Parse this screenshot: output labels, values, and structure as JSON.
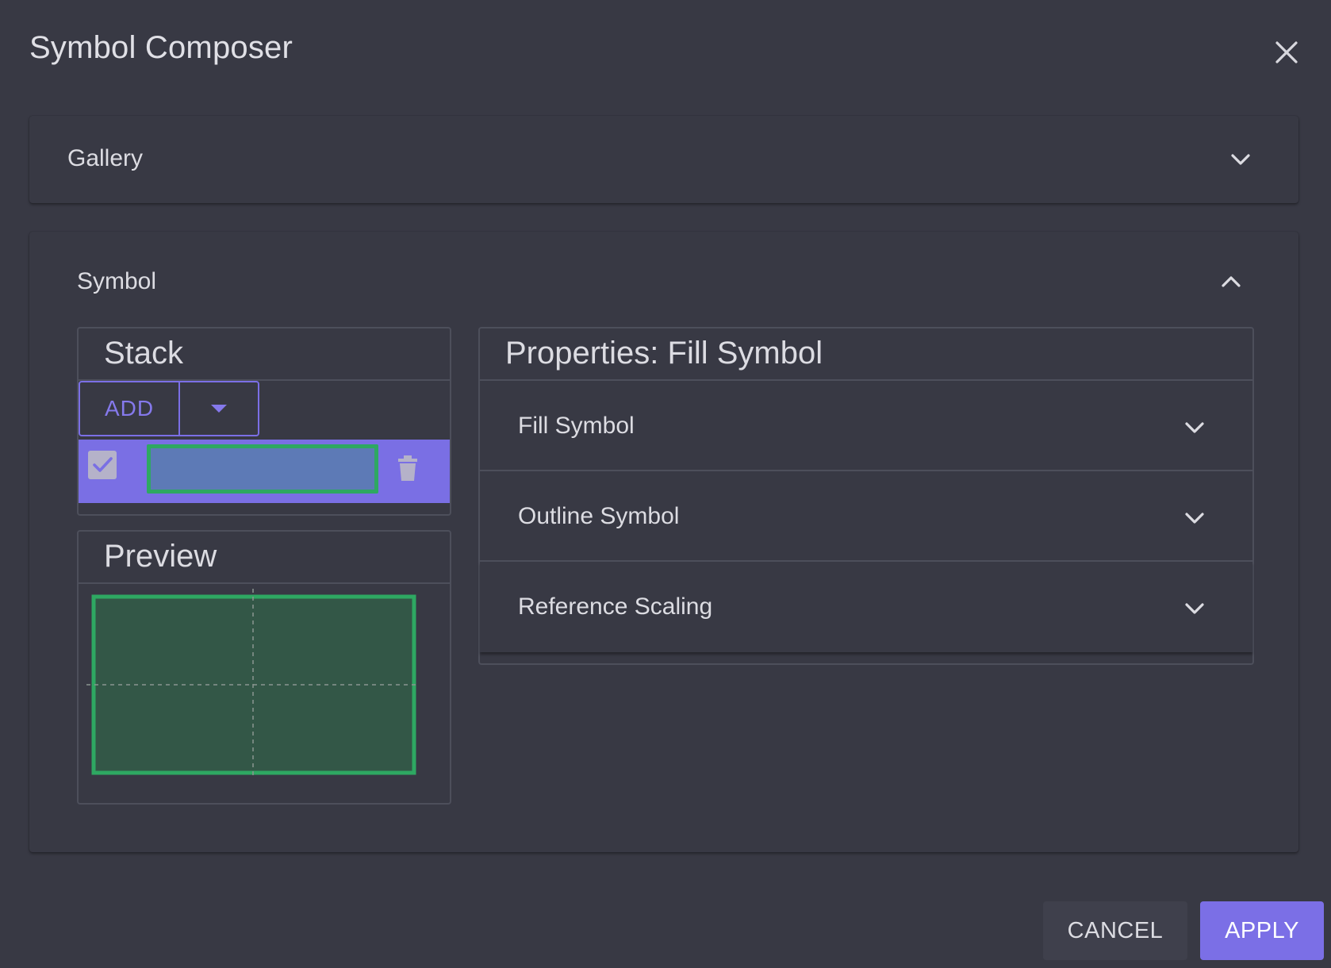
{
  "dialog": {
    "title": "Symbol Composer",
    "close_icon": "close-icon"
  },
  "gallery": {
    "label": "Gallery",
    "expanded": false
  },
  "symbol": {
    "label": "Symbol",
    "expanded": true,
    "stack": {
      "title": "Stack",
      "add_label": "ADD",
      "layers": [
        {
          "checked": true,
          "fill_color": "#5d7ab6",
          "outline_color": "#2ea862",
          "selected": true
        }
      ]
    },
    "preview": {
      "title": "Preview",
      "fill_color": "#335747",
      "outline_color": "#2ea862"
    },
    "properties": {
      "title": "Properties: Fill Symbol",
      "sections": [
        {
          "label": "Fill Symbol"
        },
        {
          "label": "Outline Symbol"
        },
        {
          "label": "Reference Scaling"
        }
      ]
    }
  },
  "footer": {
    "cancel_label": "CANCEL",
    "apply_label": "APPLY"
  },
  "colors": {
    "background": "#383944",
    "accent": "#7b6fe6",
    "outline_green": "#2ea862"
  }
}
